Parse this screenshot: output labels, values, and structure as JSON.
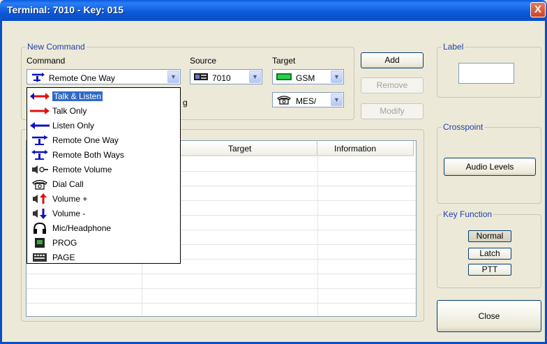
{
  "window": {
    "title": "Terminal: 7010 - Key: 015",
    "close_glyph": "X"
  },
  "new_command": {
    "group_title": "New Command",
    "command_label": "Command",
    "command_value": "Remote One Way",
    "source_label": "Source",
    "source_value": "7010",
    "target_label": "Target",
    "target_value": "GSM",
    "target2_value": "MES/",
    "partial_text": "g"
  },
  "buttons": {
    "add": "Add",
    "remove": "Remove",
    "modify": "Modify",
    "close": "Close"
  },
  "label_group": {
    "title": "Label",
    "value": ""
  },
  "crosspoint": {
    "title": "Crosspoint",
    "audio_levels": "Audio Levels"
  },
  "key_function": {
    "title": "Key Function",
    "normal": "Normal",
    "latch": "Latch",
    "ptt": "PTT"
  },
  "table": {
    "columns": [
      "Target",
      "Information"
    ]
  },
  "dropdown": {
    "items": [
      {
        "label": "Talk & Listen",
        "icon": "talk-listen-icon",
        "selected": true
      },
      {
        "label": "Talk Only",
        "icon": "talk-only-icon"
      },
      {
        "label": "Listen Only",
        "icon": "listen-only-icon"
      },
      {
        "label": "Remote One Way",
        "icon": "remote-one-way-icon"
      },
      {
        "label": "Remote Both Ways",
        "icon": "remote-both-ways-icon"
      },
      {
        "label": "Remote Volume",
        "icon": "remote-volume-icon"
      },
      {
        "label": "Dial Call",
        "icon": "dial-call-icon"
      },
      {
        "label": "Volume +",
        "icon": "volume-up-icon"
      },
      {
        "label": "Volume -",
        "icon": "volume-down-icon"
      },
      {
        "label": "Mic/Headphone",
        "icon": "mic-headphone-icon"
      },
      {
        "label": "PROG",
        "icon": "prog-icon"
      },
      {
        "label": "PAGE",
        "icon": "page-icon"
      }
    ]
  },
  "colors": {
    "titlebar": "#0a5be0",
    "group_title": "#1f3fa8",
    "selection": "#316ac5",
    "dialog_bg": "#ece9d8"
  }
}
